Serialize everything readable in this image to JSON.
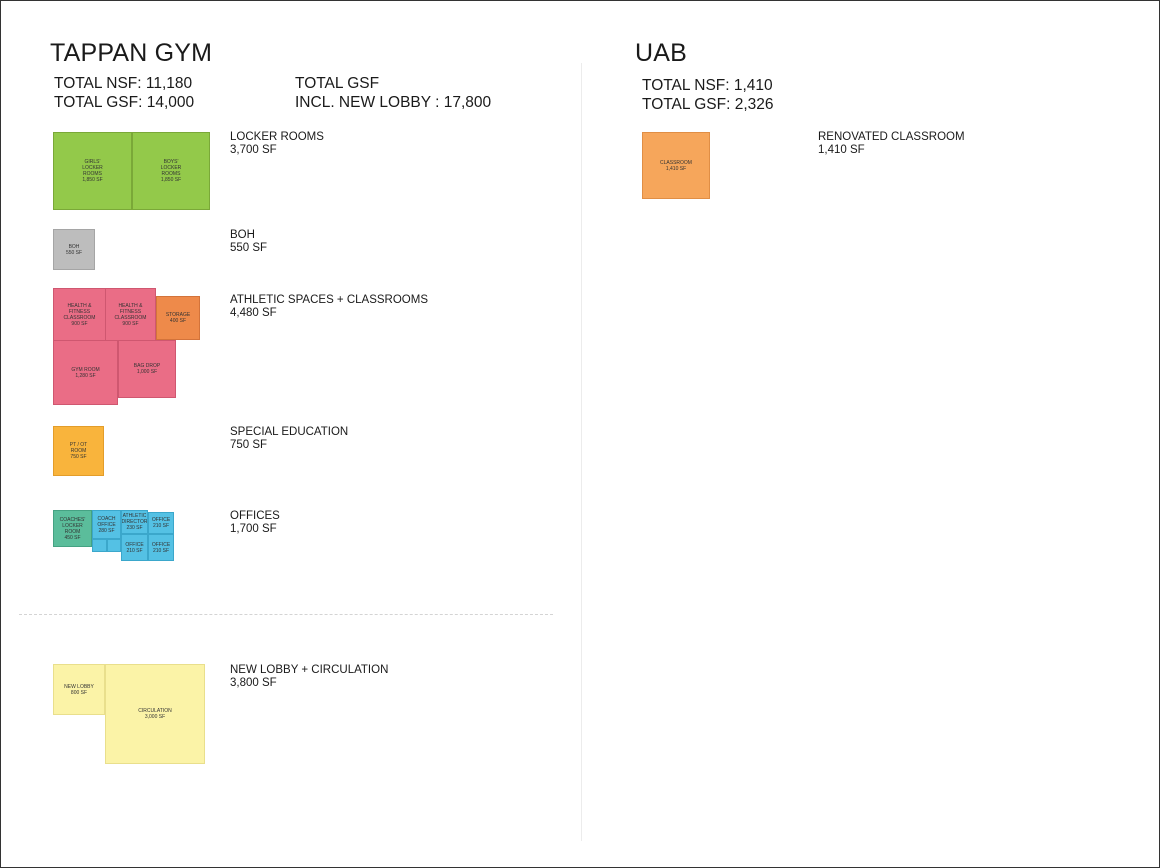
{
  "left": {
    "title": "TAPPAN GYM",
    "total_nsf": "TOTAL NSF: 11,180",
    "total_gsf": "TOTAL GSF: 14,000",
    "gsf_lobby_line1": "TOTAL GSF",
    "gsf_lobby_line2": "INCL. NEW LOBBY : 17,800",
    "categories": {
      "locker": {
        "name": "LOCKER ROOMS",
        "area": "3,700 SF"
      },
      "boh": {
        "name": "BOH",
        "area": "550 SF"
      },
      "athletic": {
        "name": "ATHLETIC SPACES + CLASSROOMS",
        "area": "4,480 SF"
      },
      "sped": {
        "name": "SPECIAL EDUCATION",
        "area": "750 SF"
      },
      "offices": {
        "name": "OFFICES",
        "area": "1,700 SF"
      },
      "lobby": {
        "name": "NEW LOBBY + CIRCULATION",
        "area": "3,800 SF"
      }
    },
    "rooms": {
      "girls_locker": "GIRLS'\nLOCKER\nROOMS\n1,850 SF",
      "boys_locker": "BOYS'\nLOCKER\nROOMS\n1,850 SF",
      "boh": "BOH\n550 SF",
      "health1": "HEALTH &\nFITNESS\nCLASSROOM\n900 SF",
      "health2": "HEALTH &\nFITNESS\nCLASSROOM\n900 SF",
      "storage": "STORAGE\n400 SF",
      "gym_room": "GYM ROOM\n1,280 SF",
      "bag_drop": "BAG DROP\n1,000 SF",
      "pt_ot": "PT / OT\nROOM\n750 SF",
      "coaches": "COACHES'\nLOCKER\nROOM\n450 SF",
      "coach_office": "COACH\nOFFICE\n280 SF",
      "athletic_director": "ATHLETIC\nDIRECTOR\n230 SF",
      "office_top": "OFFICE\n210 SF",
      "office_bottom1": "OFFICE\n210 SF",
      "office_bottom2": "OFFICE\n210 SF",
      "small1": "",
      "small2": "",
      "new_lobby": "NEW LOBBY\n800 SF",
      "circulation": "CIRCULATION\n3,000 SF"
    }
  },
  "right": {
    "title": "UAB",
    "total_nsf": "TOTAL NSF: 1,410",
    "total_gsf": "TOTAL GSF: 2,326",
    "categories": {
      "classroom": {
        "name": "RENOVATED CLASSROOM",
        "area": "1,410 SF"
      }
    },
    "rooms": {
      "classroom": "CLASSROOM\n1,410 SF"
    }
  },
  "colors": {
    "locker_green": "#93c94a",
    "boh_gray": "#bdbdbd",
    "athletic_pink": "#ea6d86",
    "storage_orange": "#ee8a4a",
    "sped_amber": "#f9b43c",
    "coaches_teal": "#5bbd9b",
    "office_cyan": "#54c1e4",
    "lobby_yellow": "#fbf3a7",
    "classroom_peach": "#f6a65b"
  }
}
